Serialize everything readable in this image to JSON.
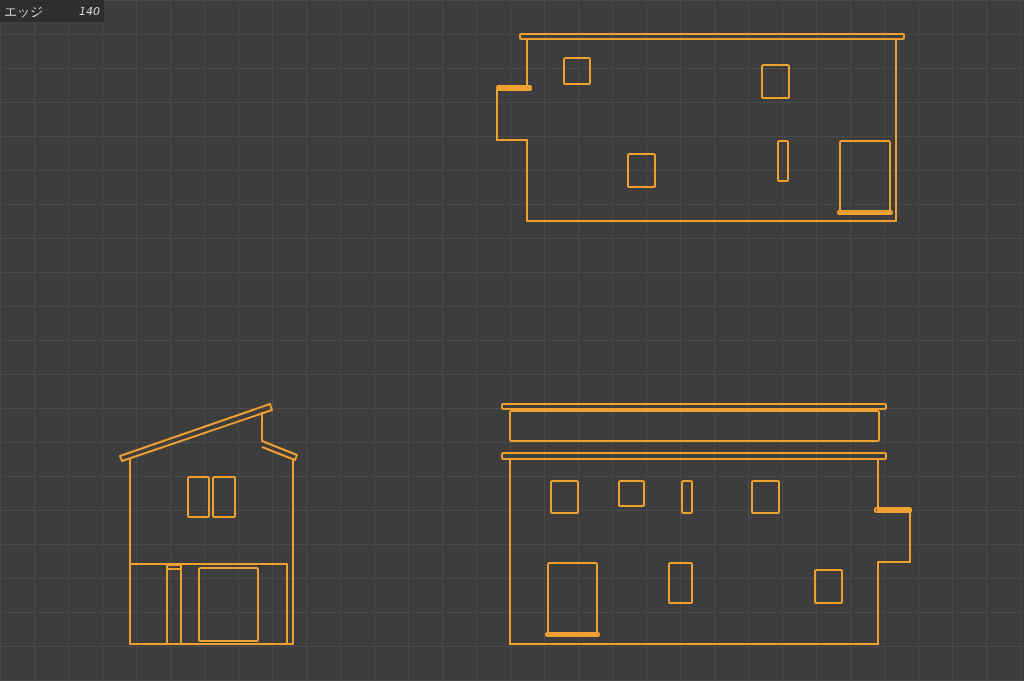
{
  "overlay": {
    "label": "エッジ",
    "value": "140"
  }
}
